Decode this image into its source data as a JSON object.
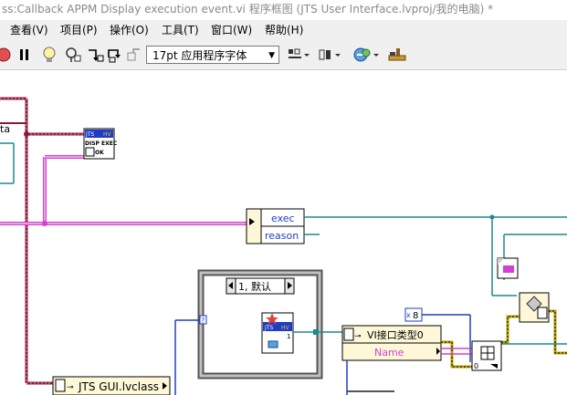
{
  "window": {
    "title": "ss:Callback APPM Display execution event.vi 程序框图 (JTS User Interface.lvproj/我的电脑) *"
  },
  "menu": {
    "items": [
      "查看(V)",
      "项目(P)",
      "操作(O)",
      "工具(T)",
      "窗口(W)",
      "帮助(H)"
    ]
  },
  "toolbar": {
    "font_select": "17pt 应用程序字体"
  },
  "diagram": {
    "fragment_a": "ta",
    "subvi_top": [
      "JTS",
      "HV",
      "DISP EXEC",
      "OK"
    ],
    "unbundle_fields": [
      "exec",
      "reason"
    ],
    "case_selector": "1, 默认",
    "class_constant": "JTS GUI.lvclass",
    "vi_type_constant": "VI接口类型0",
    "name_field": "Name",
    "numeric_constant": "8",
    "numeric_type": "x",
    "case_icon_label": "1",
    "enum_count": "0"
  },
  "colors": {
    "wire_pink": "#d43fd4",
    "wire_class": "#8b1a3a",
    "wire_teal": "#1b8a8a",
    "wire_yellow": "#b8a000",
    "wire_blue": "#1f3dc4"
  }
}
